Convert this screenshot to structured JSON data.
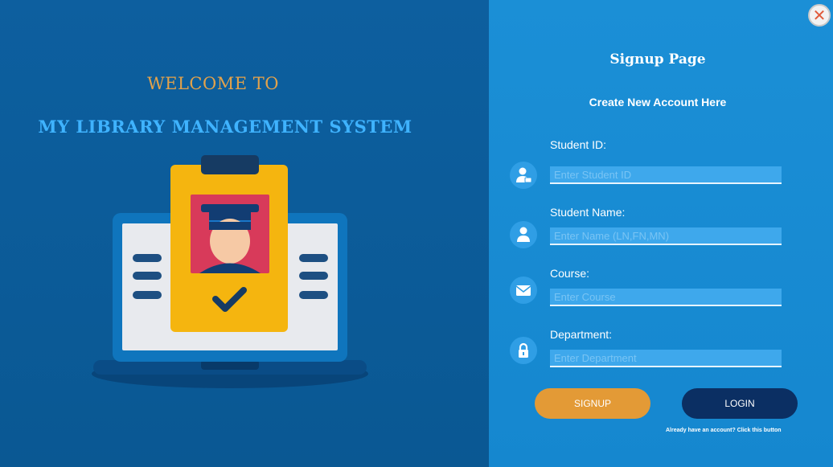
{
  "left": {
    "welcome": "WELCOME TO",
    "system_name": "MY LIBRARY MANAGEMENT SYSTEM"
  },
  "right": {
    "close_glyph": "✕",
    "title": "Signup Page",
    "subtitle": "Create New Account Here",
    "fields": [
      {
        "label": "Student ID:",
        "placeholder": "Enter Student ID",
        "icon": "id-user-icon"
      },
      {
        "label": "Student Name:",
        "placeholder": "Enter Name (LN,FN,MN)",
        "icon": "person-icon"
      },
      {
        "label": "Course:",
        "placeholder": "Enter Course",
        "icon": "mail-icon"
      },
      {
        "label": "Department:",
        "placeholder": "Enter Department",
        "icon": "lock-icon"
      }
    ],
    "signup_label": "SIGNUP",
    "login_label": "LOGIN",
    "login_hint": "Already have an account? Click this button"
  },
  "colors": {
    "left_bg": "#0d5f9f",
    "right_bg": "#1b8fd6",
    "welcome": "#e3a24a",
    "system_name": "#3fb3ff",
    "signup_button": "#e39a36",
    "login_button": "#0b2f63"
  }
}
